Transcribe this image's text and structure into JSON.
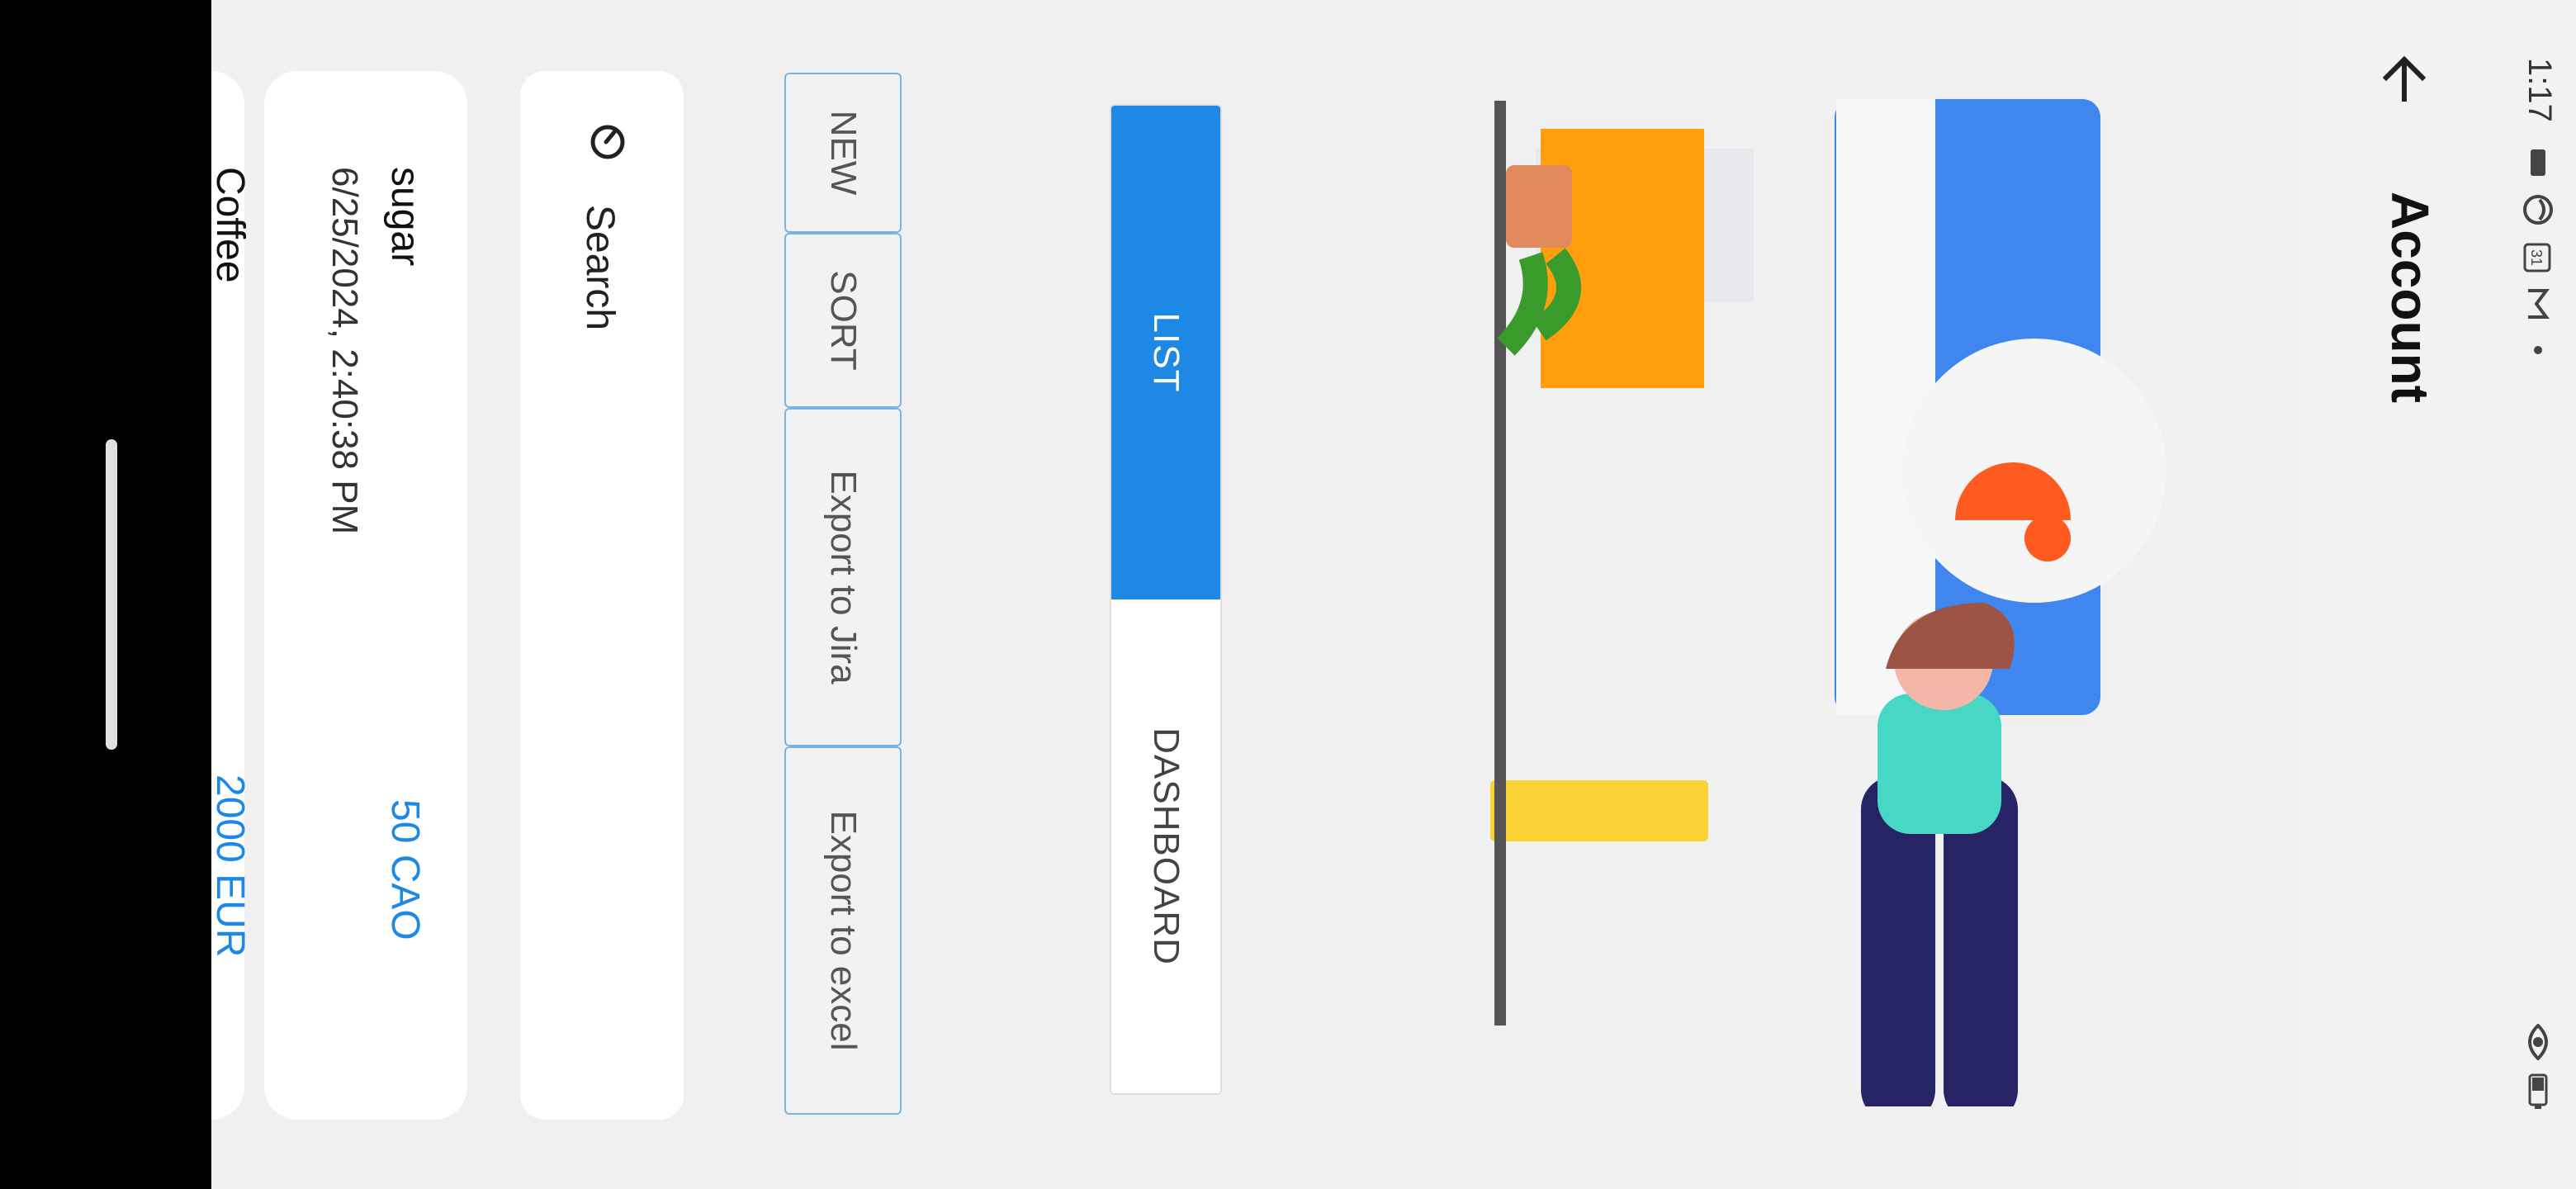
{
  "status_bar": {
    "time": "1:17",
    "left_icons": [
      "battery-small-icon",
      "face-icon",
      "calendar-icon",
      "gmail-icon",
      "dot-icon"
    ],
    "calendar_day": "31",
    "right_icons": [
      "eye-icon",
      "battery-icon"
    ]
  },
  "app_bar": {
    "title": "Account"
  },
  "segment": {
    "list_label": "LIST",
    "dashboard_label": "DASHBOARD"
  },
  "actions": {
    "new": "NEW",
    "sort": "SORT",
    "export_jira": "Export to Jira",
    "export_excel": "Export to excel"
  },
  "search": {
    "label": "Search"
  },
  "items": [
    {
      "name": "sugar",
      "date": "6/25/2024, 2:40:38 PM",
      "amount": "50 CAO"
    },
    {
      "name": "Coffee",
      "amount": "2000 EUR"
    }
  ],
  "colors": {
    "accent": "#1e88e5",
    "background": "#f0f0f0",
    "card": "#ffffff"
  }
}
